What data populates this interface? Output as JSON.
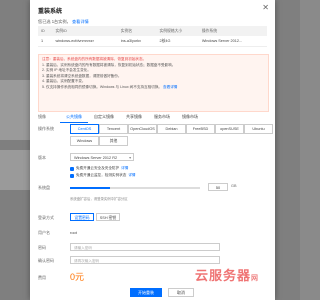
{
  "dialog": {
    "title": "重装系统",
    "selected_text": "您已选 1台实例，",
    "view_details": "查看详情",
    "table": {
      "headers": [
        "ID",
        "实例ID",
        "实例名",
        "实例规格大小",
        "操作系统"
      ],
      "rows": [
        [
          "1",
          "windows-ecfdvnmrvxzr",
          "ins-a3lyorkv",
          "2核4G",
          "Windows Server 2012..."
        ]
      ]
    },
    "notice_lines": [
      "注意：重装后，系统盘内的所有数据将被清除，恢复到初始状态。",
      "1. 重装后，实例系统盘内的所有数据将被清除，恢复到初始状态；数据盘不受影响。",
      "2. 实例 IP 地址不会发生变化。",
      "3. 重装系统将清空系统盘数据，请提前做好备份。",
      "4. 重装后，实例配置不变。",
      "5. 仅支持操作系统相同的镜像切换。Windows 与 Linux 间不支持互相切换。"
    ],
    "notice_link": "查看详情",
    "image_label": "镜像",
    "tabs": [
      "公共镜像",
      "自定义镜像",
      "共享镜像",
      "服务市场",
      "镜像市场"
    ],
    "os_label": "操作系统",
    "os_options": [
      [
        "CentOS",
        "Tencent",
        "OpenCloudOS",
        "Debian",
        "FreeBSD",
        "openSUSE",
        "Ubuntu"
      ],
      [
        "Windows",
        "其他"
      ]
    ],
    "version_label": "版本",
    "version_value": "Windows Server 2012 R2",
    "check_1": "免费开通云安全及安全防护",
    "check_1_link": "详情",
    "check_2": "免费开通云监控，检测实例状态",
    "check_2_link": "详情",
    "disk_label": "系统盘",
    "disk_value": "50",
    "disk_unit": "GB",
    "disk_note": "系统盘扩容后，请登录实例中扩容分区",
    "login_label": "登录方式",
    "login_options": [
      "设置密码",
      "SSH 密钥",
      "自动生成密码"
    ],
    "user_label": "用户名",
    "user_value": "root",
    "password_label": "密码",
    "password_placeholder": "请输入密码",
    "confirm_label": "确认密码",
    "confirm_placeholder": "请再次输入密码",
    "price_label": "费用",
    "price": "0元",
    "start_button": "开始重装",
    "cancel_button": "取消",
    "close_icon": "close-icon"
  },
  "watermark": {
    "text": "云服务器",
    "suffix": "网"
  },
  "colors": {
    "accent": "#006eff",
    "warning": "#e54545",
    "price": "#ff7200"
  }
}
